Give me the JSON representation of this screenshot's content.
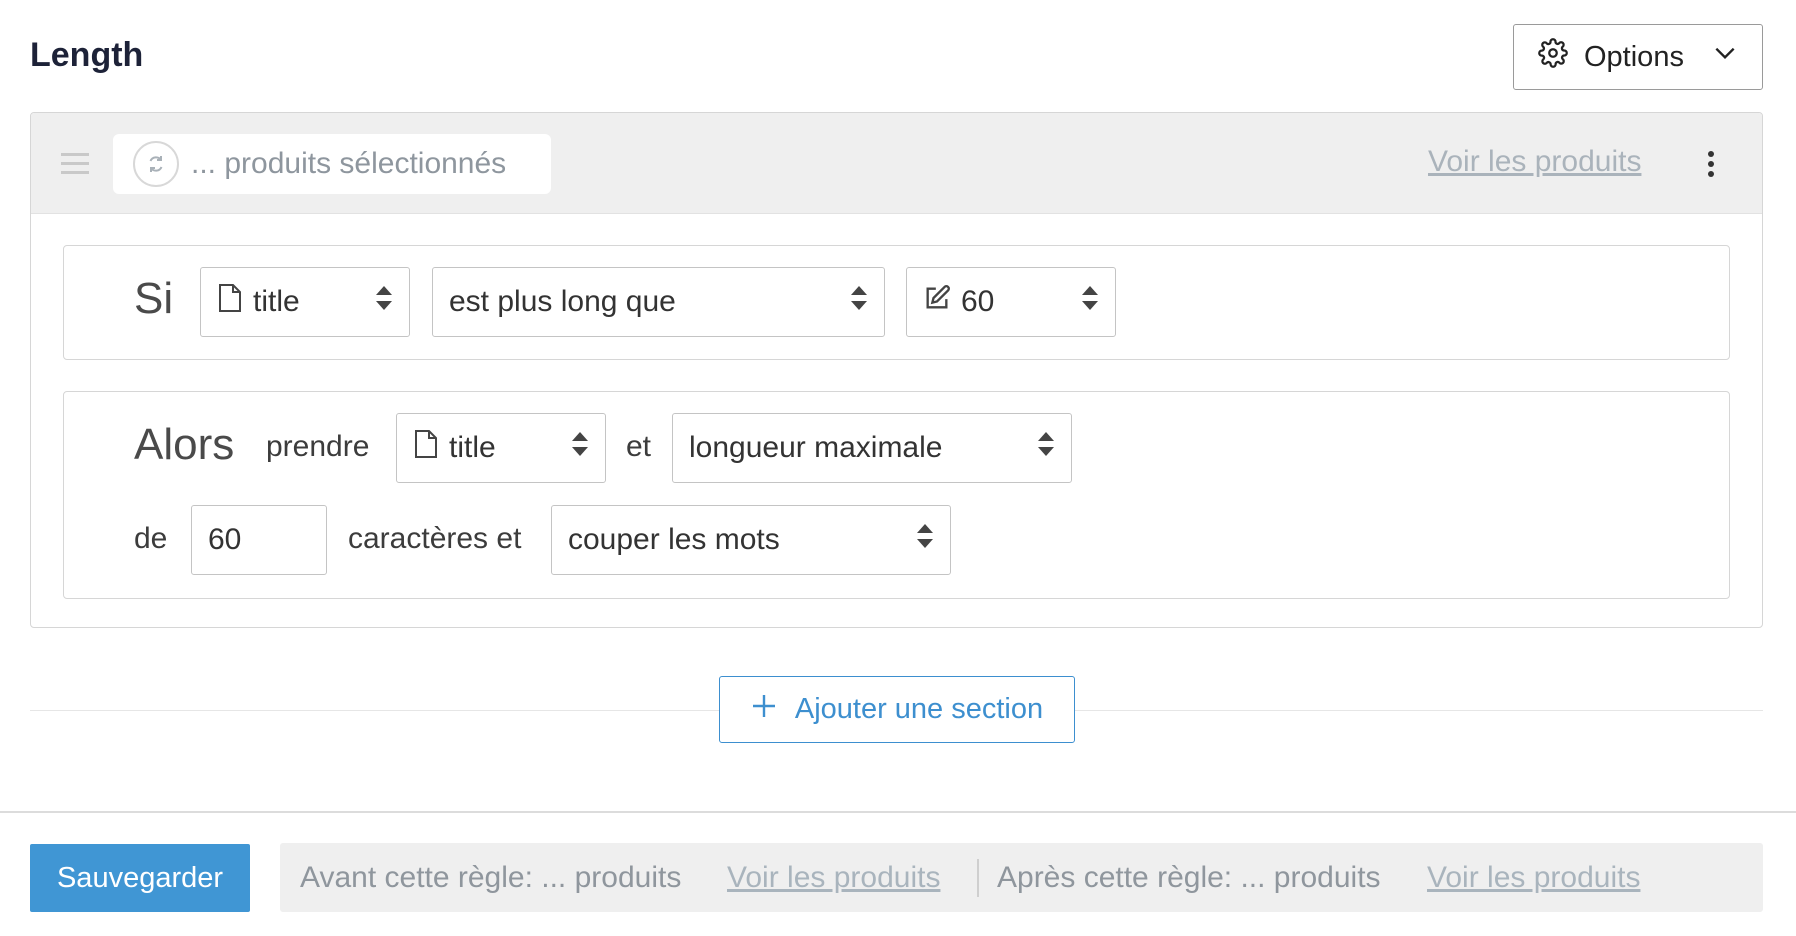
{
  "header": {
    "title": "Length",
    "options_label": "Options",
    "options_icon": "gear-icon",
    "options_chevron": "chevron-down-icon"
  },
  "section": {
    "selected_products": "... produits sélectionnés",
    "view_products_link": "Voir les produits",
    "condition": {
      "if_label": "Si",
      "field_value": "title",
      "operator_value": "est plus long que",
      "compare_value": "60"
    },
    "action": {
      "then_label": "Alors",
      "take_label": "prendre",
      "field_value": "title",
      "and_label": "et",
      "mode_value": "longueur maximale",
      "of_label": "de",
      "length_value": "60",
      "chars_and_label": "caractères et",
      "cut_value": "couper les mots"
    }
  },
  "add_section_label": "Ajouter une section",
  "footer": {
    "save_label": "Sauvegarder",
    "before_text": "Avant cette règle: ... produits",
    "before_link": "Voir les produits",
    "after_text": "Après cette règle: ... produits",
    "after_link": "Voir les produits"
  },
  "colors": {
    "accent": "#4096d4",
    "link_muted": "#aab3bb",
    "panel_head_bg": "#efefef"
  }
}
